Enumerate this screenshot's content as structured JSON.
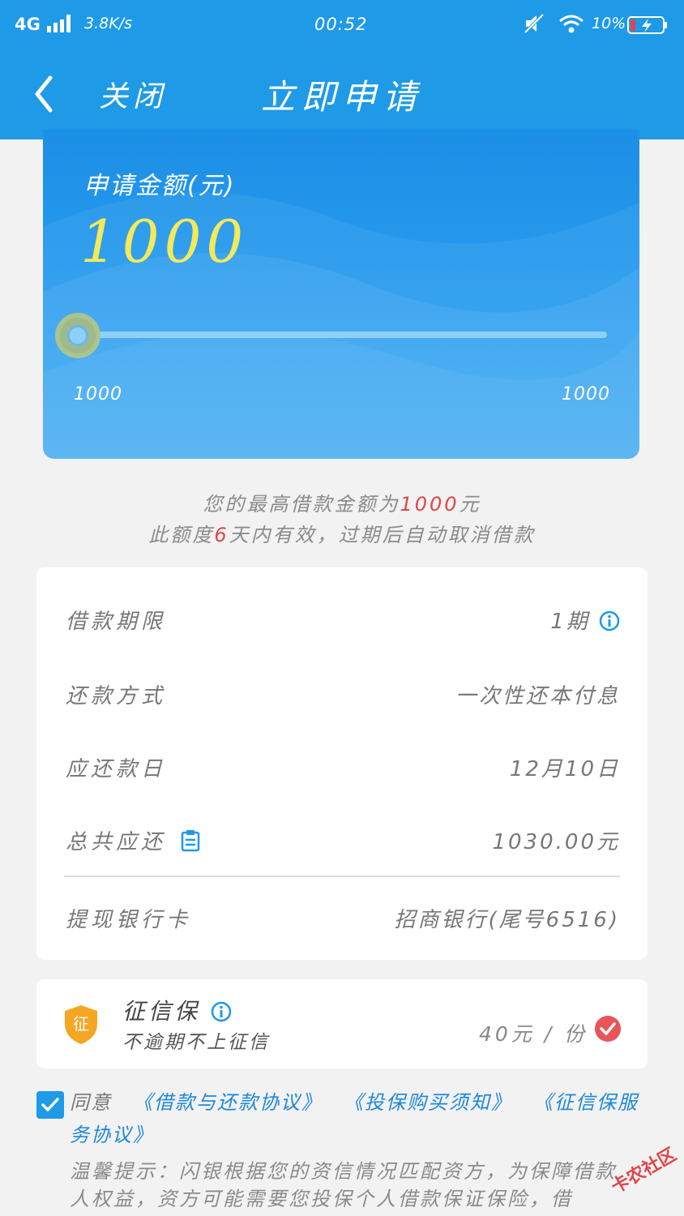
{
  "status_bar": {
    "network": "4G",
    "speed": "3.8K/s",
    "time": "00:52",
    "battery_percent": "10%"
  },
  "header": {
    "close_label": "关闭",
    "title": "立即申请"
  },
  "amount_card": {
    "label": "申请金额(元)",
    "amount": "1000",
    "range_min": "1000",
    "range_max": "1000",
    "slider_value_fraction": 0
  },
  "notice": {
    "line1_prefix": "您的最高借款金额为",
    "line1_amount": "1000",
    "line1_suffix": "元",
    "line2_prefix": "此额度",
    "line2_days": "6",
    "line2_suffix": "天内有效，过期后自动取消借款"
  },
  "details": {
    "term_label": "借款期限",
    "term_value": "1期",
    "method_label": "还款方式",
    "method_value": "一次性还本付息",
    "due_label": "应还款日",
    "due_value": "12月10日",
    "total_label": "总共应还",
    "total_value": "1030.00元",
    "bank_label": "提现银行卡",
    "bank_value": "招商银行(尾号6516)"
  },
  "insurance": {
    "badge": "征",
    "title": "征信保",
    "subtitle": "不逾期不上征信",
    "price": "40元 / 份",
    "checked": true
  },
  "agreement": {
    "prefix": "同意",
    "link1": "《借款与还款协议》",
    "link2": "《投保购买须知》",
    "link3": "《征信保服务协议》",
    "checked": true
  },
  "tip": {
    "text": "温馨提示：闪银根据您的资信情况匹配资方，为保障借款人权益，资方可能需要您投保个人借款保证保险，借"
  },
  "watermark": {
    "text": "卡农社区"
  },
  "colors": {
    "brand_blue": "#1e9ae6",
    "amount_yellow": "#f4e95a",
    "accent_red": "#e0454a",
    "shield_orange": "#f5a623"
  }
}
